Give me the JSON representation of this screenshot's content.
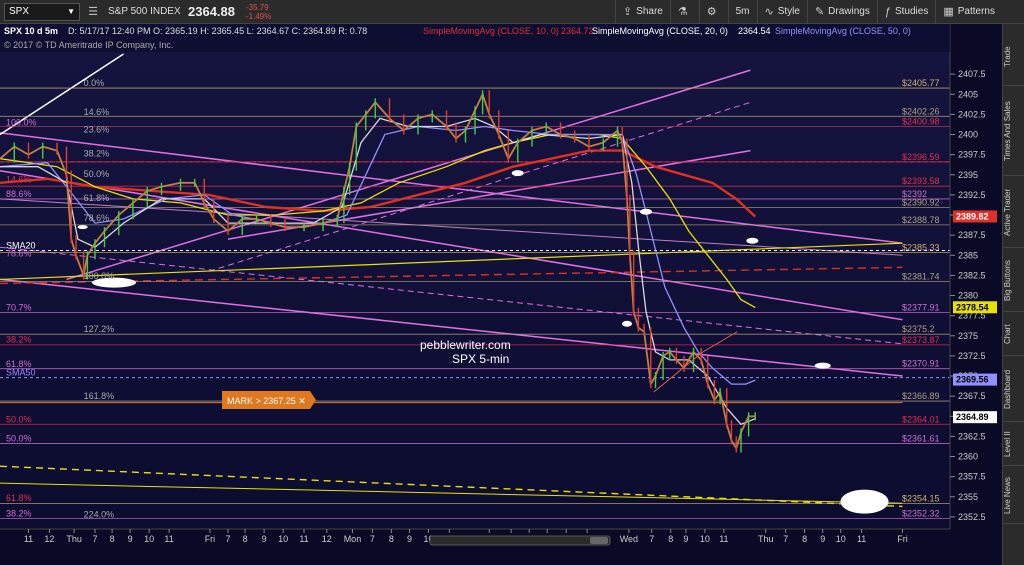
{
  "toolbar": {
    "symbol": "SPX",
    "index_name": "S&P 500 INDEX",
    "last_price": "2364.88",
    "change": "-35.79",
    "change_pct": "-1.49%",
    "share": "Share",
    "interval": "5m",
    "style": "Style",
    "drawings": "Drawings",
    "studies": "Studies",
    "patterns": "Patterns"
  },
  "sidebar": [
    "Trade",
    "Times And Sales",
    "Active Trader",
    "Big Buttons",
    "Chart",
    "Dashboard",
    "Level II",
    "Live News"
  ],
  "info_bar": {
    "symbol": "SPX 10 d 5m",
    "ohlc": "D: 5/17/17 12:40 PM  O: 2365.19  H: 2365.45  L: 2364.67  C: 2364.89  R: 0.78",
    "sma10": "SimpleMovingAvg (CLOSE, 10, 0)",
    "sma10_val": "2364.72",
    "sma20": "SimpleMovingAvg (CLOSE, 20, 0)",
    "sma20_val": "2364.54",
    "sma50": "SimpleMovingAvg (CLOSE, 50, 0)",
    "copyright": "© 2017 © TD Ameritrade IP Company, Inc."
  },
  "watermark": {
    "line1": "pebblewriter.com",
    "line2": "SPX 5-min"
  },
  "mark_label": "MARK > 2367.25 ✕",
  "chart_data": {
    "type": "line",
    "y_axis": {
      "min": 2351,
      "max": 2410,
      "ticks": [
        "2407.5",
        "2405",
        "2402.5",
        "2400",
        "2397.5",
        "2395",
        "2392.5",
        "2390",
        "2387.5",
        "2385",
        "2382.5",
        "2380",
        "2377.5",
        "2375",
        "2372.5",
        "2370",
        "2367.5",
        "2365",
        "2362.5",
        "2360",
        "2357.5",
        "2355",
        "2352.5"
      ]
    },
    "x_axis": {
      "min": 0,
      "max": 1000,
      "ticks": [
        {
          "l": "11",
          "x": 30
        },
        {
          "l": "12",
          "x": 52
        },
        {
          "l": "Thu",
          "x": 78
        },
        {
          "l": "7",
          "x": 100
        },
        {
          "l": "8",
          "x": 118
        },
        {
          "l": "9",
          "x": 137
        },
        {
          "l": "10",
          "x": 157
        },
        {
          "l": "11",
          "x": 178
        },
        {
          "l": "Fri",
          "x": 221
        },
        {
          "l": "7",
          "x": 240
        },
        {
          "l": "8",
          "x": 258
        },
        {
          "l": "9",
          "x": 278
        },
        {
          "l": "10",
          "x": 298
        },
        {
          "l": "11",
          "x": 320
        },
        {
          "l": "12",
          "x": 344
        },
        {
          "l": "Mon",
          "x": 371
        },
        {
          "l": "7",
          "x": 392
        },
        {
          "l": "8",
          "x": 412
        },
        {
          "l": "9",
          "x": 431
        },
        {
          "l": "10",
          "x": 451
        },
        {
          "l": "11",
          "x": 473
        },
        {
          "l": "Tue",
          "x": 515
        },
        {
          "l": "7",
          "x": 538
        },
        {
          "l": "8",
          "x": 557
        },
        {
          "l": "9",
          "x": 576
        },
        {
          "l": "10",
          "x": 596
        },
        {
          "l": "11",
          "x": 618
        },
        {
          "l": "Wed",
          "x": 662
        },
        {
          "l": "7",
          "x": 686
        },
        {
          "l": "8",
          "x": 706
        },
        {
          "l": "9",
          "x": 722
        },
        {
          "l": "10",
          "x": 742
        },
        {
          "l": "11",
          "x": 762
        },
        {
          "l": "Thu",
          "x": 806
        },
        {
          "l": "7",
          "x": 827
        },
        {
          "l": "8",
          "x": 847
        },
        {
          "l": "9",
          "x": 866
        },
        {
          "l": "10",
          "x": 885
        },
        {
          "l": "11",
          "x": 907
        },
        {
          "l": "Fri",
          "x": 950
        }
      ]
    },
    "price_tags": [
      {
        "price": 2389.82,
        "label": "2389.82",
        "bg": "#e0302a",
        "fg": "#ffffff"
      },
      {
        "price": 2378.54,
        "label": "2378.54",
        "bg": "#e8e000",
        "fg": "#000000"
      },
      {
        "price": 2369.56,
        "label": "2369.56",
        "bg": "#9090ff",
        "fg": "#000000"
      },
      {
        "price": 2364.89,
        "label": "2364.89",
        "bg": "#ffffff",
        "fg": "#000000"
      }
    ],
    "level_labels": [
      {
        "price": 2405.77,
        "label": "$2405.77",
        "color": "#d0b070"
      },
      {
        "price": 2402.26,
        "label": "$2402.26",
        "color": "#b0a080"
      },
      {
        "price": 2400.98,
        "label": "$2400.98",
        "color": "#e03050"
      },
      {
        "price": 2396.59,
        "label": "$2396.59",
        "color": "#e03050"
      },
      {
        "price": 2393.58,
        "label": "$2393.58",
        "color": "#e03050"
      },
      {
        "price": 2392,
        "label": "$2392",
        "color": "#d070d0"
      },
      {
        "price": 2390.92,
        "label": "$2390.92",
        "color": "#b0a080"
      },
      {
        "price": 2388.78,
        "label": "$2388.78",
        "color": "#b0a080"
      },
      {
        "price": 2385.33,
        "label": "$2385.33",
        "color": "#d0b070"
      },
      {
        "price": 2381.74,
        "label": "$2381.74",
        "color": "#b0a080"
      },
      {
        "price": 2377.91,
        "label": "$2377.91",
        "color": "#d070d0"
      },
      {
        "price": 2375.2,
        "label": "$2375.2",
        "color": "#b0a080"
      },
      {
        "price": 2373.87,
        "label": "$2373.87",
        "color": "#e03050"
      },
      {
        "price": 2370.91,
        "label": "$2370.91",
        "color": "#d070d0"
      },
      {
        "price": 2366.89,
        "label": "$2366.89",
        "color": "#b0a080"
      },
      {
        "price": 2364.01,
        "label": "$2364.01",
        "color": "#e03050"
      },
      {
        "price": 2361.61,
        "label": "$2361.61",
        "color": "#d070d0"
      },
      {
        "price": 2354.15,
        "label": "$2354.15",
        "color": "#d0b070"
      },
      {
        "price": 2352.32,
        "label": "$2352.32",
        "color": "#d070d0"
      }
    ],
    "left_labels": [
      {
        "price": 2400.9,
        "label": "100.0%",
        "color": "#d070d0"
      },
      {
        "price": 2393.8,
        "label": "14.6%",
        "color": "#e03050"
      },
      {
        "price": 2392,
        "label": "88.6%",
        "color": "#d070d0"
      },
      {
        "price": 2385.6,
        "label": "SMA20",
        "color": "#ffffff"
      },
      {
        "price": 2384.6,
        "label": "78.6%",
        "color": "#d070d0"
      },
      {
        "price": 2377.9,
        "label": "70.7%",
        "color": "#d070d0"
      },
      {
        "price": 2373.9,
        "label": "38.2%",
        "color": "#e03050"
      },
      {
        "price": 2370.9,
        "label": "61.8%",
        "color": "#d070d0"
      },
      {
        "price": 2369.8,
        "label": "SMA50",
        "color": "#9090ff"
      },
      {
        "price": 2364,
        "label": "50.0%",
        "color": "#e03050"
      },
      {
        "price": 2361.6,
        "label": "50.0%",
        "color": "#d070d0"
      },
      {
        "price": 2354.2,
        "label": "61.8%",
        "color": "#e03050"
      },
      {
        "price": 2352.3,
        "label": "38.2%",
        "color": "#d070d0"
      }
    ],
    "fib_labels": [
      {
        "x": 88,
        "price": 2405.8,
        "label": "0.0%"
      },
      {
        "x": 88,
        "price": 2402.2,
        "label": "14.6%"
      },
      {
        "x": 88,
        "price": 2400,
        "label": "23.6%"
      },
      {
        "x": 88,
        "price": 2397,
        "label": "38.2%"
      },
      {
        "x": 88,
        "price": 2394.5,
        "label": "50.0%"
      },
      {
        "x": 88,
        "price": 2391.5,
        "label": "61.8%"
      },
      {
        "x": 88,
        "price": 2389,
        "label": "78.6%"
      },
      {
        "x": 88,
        "price": 2375.2,
        "label": "127.2%"
      },
      {
        "x": 88,
        "price": 2366.9,
        "label": "161.8%"
      },
      {
        "x": 88,
        "price": 2352.2,
        "label": "224.0%"
      },
      {
        "x": 88,
        "price": 2381.8,
        "label": "100.0%"
      }
    ],
    "series": [
      {
        "key": "price",
        "color": "#c08040",
        "points": [
          [
            0,
            2397
          ],
          [
            15,
            2398.5
          ],
          [
            30,
            2397.5
          ],
          [
            45,
            2398.5
          ],
          [
            60,
            2398
          ],
          [
            70,
            2395
          ],
          [
            75,
            2387
          ],
          [
            80,
            2385
          ],
          [
            88,
            2382.5
          ],
          [
            92,
            2385
          ],
          [
            100,
            2386.5
          ],
          [
            110,
            2388
          ],
          [
            125,
            2390
          ],
          [
            140,
            2391.5
          ],
          [
            155,
            2393
          ],
          [
            170,
            2393.5
          ],
          [
            190,
            2394
          ],
          [
            205,
            2394
          ],
          [
            215,
            2391.5
          ],
          [
            225,
            2389.5
          ],
          [
            240,
            2388
          ],
          [
            255,
            2389.5
          ],
          [
            270,
            2389.5
          ],
          [
            285,
            2389
          ],
          [
            300,
            2388.5
          ],
          [
            320,
            2388.5
          ],
          [
            340,
            2389
          ],
          [
            355,
            2389.5
          ],
          [
            362,
            2393
          ],
          [
            368,
            2396
          ],
          [
            375,
            2401
          ],
          [
            385,
            2402.5
          ],
          [
            395,
            2404
          ],
          [
            410,
            2402
          ],
          [
            425,
            2400.5
          ],
          [
            440,
            2402
          ],
          [
            455,
            2402.5
          ],
          [
            470,
            2401
          ],
          [
            480,
            2399.5
          ],
          [
            490,
            2400.5
          ],
          [
            500,
            2403
          ],
          [
            508,
            2405
          ],
          [
            515,
            2402.5
          ],
          [
            525,
            2400
          ],
          [
            535,
            2397
          ],
          [
            545,
            2399
          ],
          [
            560,
            2400.5
          ],
          [
            575,
            2401
          ],
          [
            590,
            2400
          ],
          [
            605,
            2399.5
          ],
          [
            620,
            2398.5
          ],
          [
            635,
            2399
          ],
          [
            650,
            2400.5
          ],
          [
            655,
            2399
          ],
          [
            660,
            2392
          ],
          [
            663,
            2385
          ],
          [
            667,
            2378
          ],
          [
            672,
            2376
          ],
          [
            678,
            2375.5
          ],
          [
            685,
            2369
          ],
          [
            690,
            2370
          ],
          [
            698,
            2372.5
          ],
          [
            705,
            2373
          ],
          [
            712,
            2372
          ],
          [
            720,
            2371
          ],
          [
            730,
            2373
          ],
          [
            738,
            2372
          ],
          [
            745,
            2369
          ],
          [
            752,
            2367
          ],
          [
            758,
            2368
          ],
          [
            765,
            2364
          ],
          [
            770,
            2362
          ],
          [
            775,
            2361
          ],
          [
            780,
            2363
          ],
          [
            788,
            2365
          ],
          [
            795,
            2365
          ]
        ]
      },
      {
        "key": "sma10",
        "color": "#d8d8d8",
        "points": [
          [
            0,
            2396
          ],
          [
            40,
            2396
          ],
          [
            70,
            2394
          ],
          [
            82,
            2387
          ],
          [
            100,
            2386
          ],
          [
            130,
            2389
          ],
          [
            170,
            2392
          ],
          [
            215,
            2392
          ],
          [
            240,
            2389
          ],
          [
            280,
            2389
          ],
          [
            330,
            2389
          ],
          [
            360,
            2391
          ],
          [
            380,
            2399
          ],
          [
            400,
            2402
          ],
          [
            430,
            2401
          ],
          [
            470,
            2401
          ],
          [
            500,
            2402
          ],
          [
            520,
            2401
          ],
          [
            540,
            2399
          ],
          [
            570,
            2400
          ],
          [
            620,
            2399.5
          ],
          [
            655,
            2400
          ],
          [
            665,
            2394
          ],
          [
            672,
            2386
          ],
          [
            680,
            2378
          ],
          [
            690,
            2373
          ],
          [
            705,
            2372
          ],
          [
            725,
            2372
          ],
          [
            745,
            2370
          ],
          [
            765,
            2366
          ],
          [
            780,
            2364
          ],
          [
            795,
            2364.7
          ]
        ]
      },
      {
        "key": "sma20",
        "color": "#9090ff",
        "points": [
          [
            0,
            2396
          ],
          [
            50,
            2396.5
          ],
          [
            80,
            2392
          ],
          [
            100,
            2389
          ],
          [
            130,
            2389.5
          ],
          [
            175,
            2392
          ],
          [
            215,
            2392.5
          ],
          [
            245,
            2390
          ],
          [
            290,
            2389
          ],
          [
            340,
            2389
          ],
          [
            365,
            2390
          ],
          [
            385,
            2395
          ],
          [
            405,
            2400
          ],
          [
            440,
            2401
          ],
          [
            480,
            2400.5
          ],
          [
            510,
            2401
          ],
          [
            540,
            2400.5
          ],
          [
            580,
            2400
          ],
          [
            630,
            2400
          ],
          [
            655,
            2400
          ],
          [
            670,
            2395
          ],
          [
            685,
            2388
          ],
          [
            700,
            2381
          ],
          [
            720,
            2376
          ],
          [
            735,
            2373
          ],
          [
            750,
            2371
          ],
          [
            770,
            2369
          ],
          [
            785,
            2369
          ],
          [
            795,
            2369.5
          ]
        ]
      },
      {
        "key": "sma50",
        "color": "#e8e000",
        "points": [
          [
            0,
            2397
          ],
          [
            60,
            2396
          ],
          [
            100,
            2393.5
          ],
          [
            140,
            2392
          ],
          [
            190,
            2391.5
          ],
          [
            240,
            2390
          ],
          [
            290,
            2390
          ],
          [
            340,
            2390.5
          ],
          [
            380,
            2391.5
          ],
          [
            420,
            2394
          ],
          [
            470,
            2396
          ],
          [
            510,
            2398
          ],
          [
            540,
            2399
          ],
          [
            580,
            2400
          ],
          [
            630,
            2400
          ],
          [
            655,
            2399.5
          ],
          [
            680,
            2396
          ],
          [
            705,
            2392
          ],
          [
            725,
            2388
          ],
          [
            745,
            2385
          ],
          [
            765,
            2382
          ],
          [
            780,
            2379.5
          ],
          [
            795,
            2378.5
          ]
        ]
      },
      {
        "key": "sma200",
        "color": "#e03020",
        "points": [
          [
            0,
            2394
          ],
          [
            50,
            2394.5
          ],
          [
            100,
            2393.5
          ],
          [
            160,
            2393
          ],
          [
            220,
            2392.5
          ],
          [
            280,
            2391
          ],
          [
            340,
            2390.5
          ],
          [
            390,
            2391
          ],
          [
            440,
            2392.5
          ],
          [
            490,
            2394
          ],
          [
            540,
            2396
          ],
          [
            580,
            2397
          ],
          [
            620,
            2398
          ],
          [
            655,
            2398
          ],
          [
            690,
            2396
          ],
          [
            720,
            2395
          ],
          [
            750,
            2394
          ],
          [
            775,
            2392
          ],
          [
            795,
            2389.8
          ]
        ]
      }
    ]
  }
}
